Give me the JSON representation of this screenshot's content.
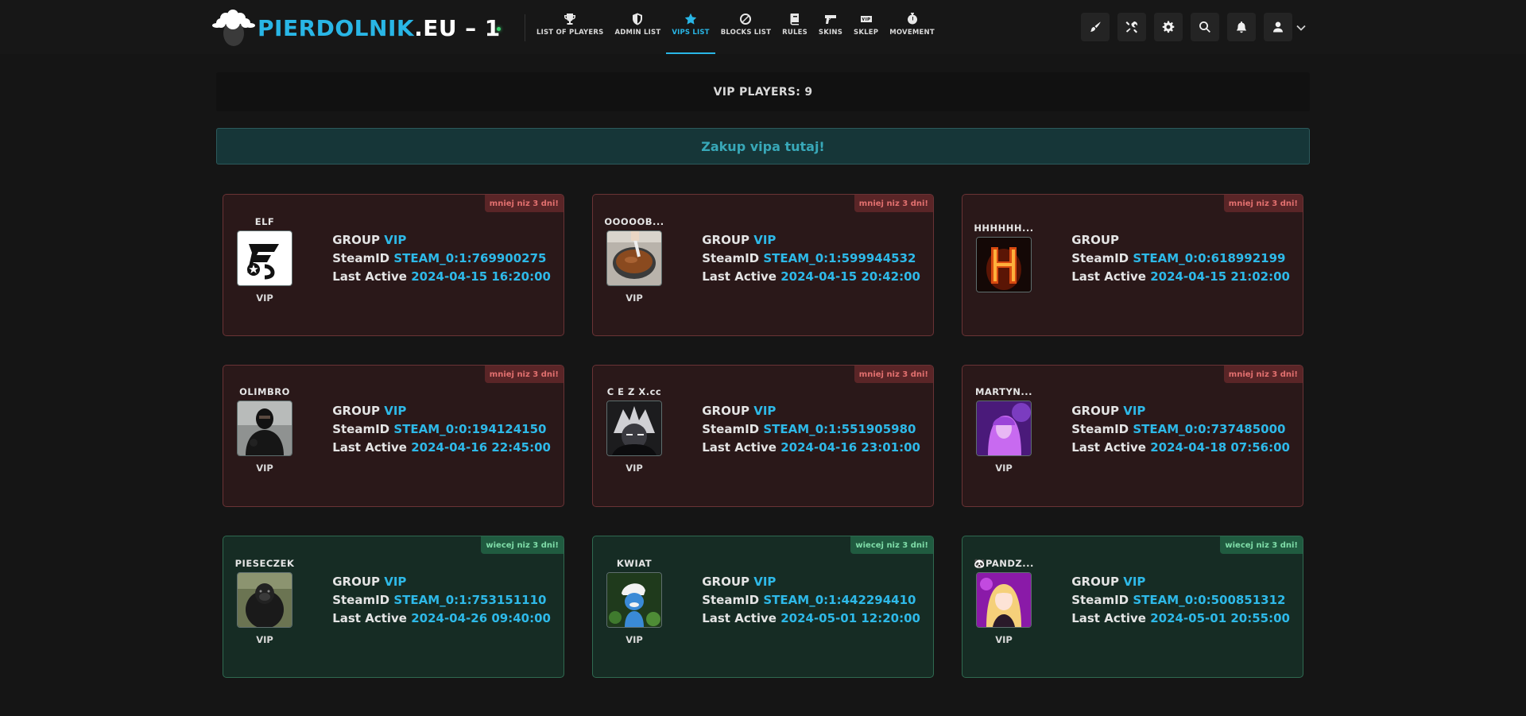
{
  "brand": {
    "main": "PIERDOLNIK",
    "tld": ".EU",
    "suffix": "– 1"
  },
  "nav": [
    {
      "label": "LIST OF PLAYERS",
      "icon": "trophy-icon"
    },
    {
      "label": "ADMIN LIST",
      "icon": "shield-icon"
    },
    {
      "label": "VIPS LIST",
      "icon": "star-icon",
      "active": true
    },
    {
      "label": "BLOCKS LIST",
      "icon": "ban-icon"
    },
    {
      "label": "RULES",
      "icon": "book-icon"
    },
    {
      "label": "SKINS",
      "icon": "gun-icon"
    },
    {
      "label": "SKLEP",
      "icon": "vip-ticket-icon"
    },
    {
      "label": "MOVEMENT",
      "icon": "stopwatch-icon"
    }
  ],
  "tools": [
    "brush-icon",
    "tools-icon",
    "gear-icon",
    "search-icon",
    "bell-icon",
    "user-icon"
  ],
  "vip_count": "VIP PLAYERS: 9",
  "buy_vip": "Zakup vipa tutaj!",
  "labels": {
    "group": "GROUP",
    "steamid": "SteamID",
    "last_active": "Last Active"
  },
  "colors": {
    "accent": "#29b6e6",
    "expiring": "#2a1819",
    "ok": "#162c24"
  },
  "players": [
    {
      "name": "ELF",
      "role": "VIP",
      "group": "VIP",
      "steamid": "STEAM_0:1:769900275",
      "last_active": "2024-04-15 16:20:00",
      "tag": "mniej niz 3 dni!",
      "status": "expiring"
    },
    {
      "name": "OOOOOB...",
      "role": "VIP",
      "group": "VIP",
      "steamid": "STEAM_0:1:599944532",
      "last_active": "2024-04-15 20:42:00",
      "tag": "mniej niz 3 dni!",
      "status": "expiring"
    },
    {
      "name": "HHHHHH...",
      "role": "",
      "group": "",
      "steamid": "STEAM_0:0:618992199",
      "last_active": "2024-04-15 21:02:00",
      "tag": "mniej niz 3 dni!",
      "status": "expiring"
    },
    {
      "name": "OLIMBRO",
      "role": "VIP",
      "group": "VIP",
      "steamid": "STEAM_0:0:194124150",
      "last_active": "2024-04-16 22:45:00",
      "tag": "mniej niz 3 dni!",
      "status": "expiring"
    },
    {
      "name": "C E Z X.cc",
      "role": "VIP",
      "group": "VIP",
      "steamid": "STEAM_0:1:551905980",
      "last_active": "2024-04-16 23:01:00",
      "tag": "mniej niz 3 dni!",
      "status": "expiring"
    },
    {
      "name": "MARTYN...",
      "role": "VIP",
      "group": "VIP",
      "steamid": "STEAM_0:0:737485000",
      "last_active": "2024-04-18 07:56:00",
      "tag": "mniej niz 3 dni!",
      "status": "expiring"
    },
    {
      "name": "PIESECZEK",
      "role": "VIP",
      "group": "VIP",
      "steamid": "STEAM_0:1:753151110",
      "last_active": "2024-04-26 09:40:00",
      "tag": "wiecej niz 3 dni!",
      "status": "ok"
    },
    {
      "name": "KWIAT",
      "role": "VIP",
      "group": "VIP",
      "steamid": "STEAM_0:1:442294410",
      "last_active": "2024-05-01 12:20:00",
      "tag": "wiecej niz 3 dni!",
      "status": "ok"
    },
    {
      "name": "🐼PANDZ...",
      "role": "VIP",
      "group": "VIP",
      "steamid": "STEAM_0:0:500851312",
      "last_active": "2024-05-01 20:55:00",
      "tag": "wiecej niz 3 dni!",
      "status": "ok"
    }
  ]
}
